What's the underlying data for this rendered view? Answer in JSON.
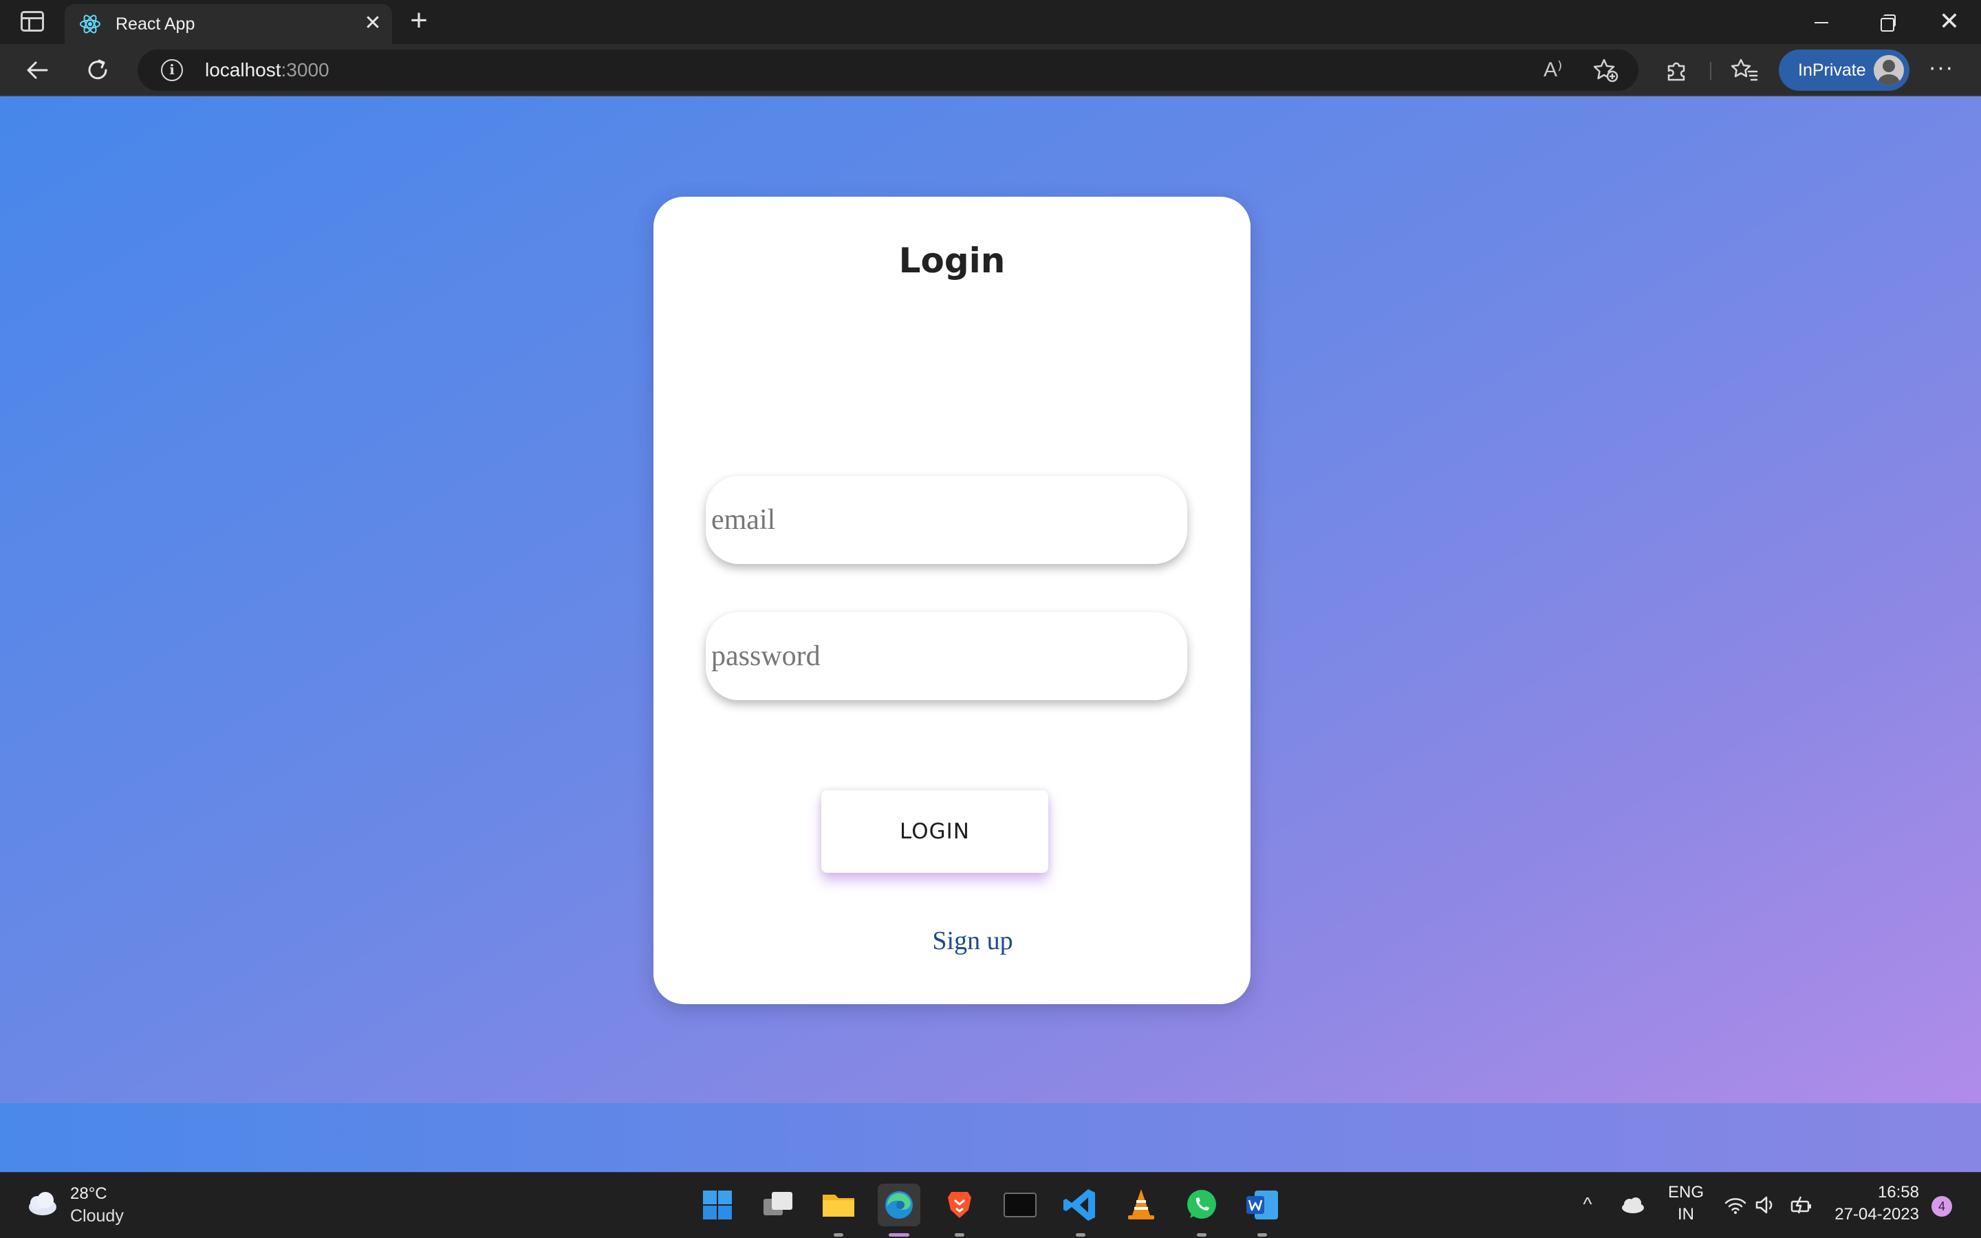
{
  "browser": {
    "tab_title": "React App",
    "url_host": "localhost",
    "url_port": ":3000",
    "inprivate_label": "InPrivate",
    "close_glyph": "✕",
    "new_tab_glyph": "+",
    "more_glyph": "···",
    "read_aloud_glyph": "A⁾",
    "info_glyph": "i",
    "win_close_glyph": "✕"
  },
  "login_card": {
    "title": "Login",
    "email_placeholder": "email",
    "password_placeholder": "password",
    "login_button": "LOGIN",
    "signup_link": "Sign up"
  },
  "taskbar": {
    "weather_temp": "28°C",
    "weather_desc": "Cloudy",
    "language_line1": "ENG",
    "language_line2": "IN",
    "time": "16:58",
    "date": "27-04-2023",
    "notification_count": "4",
    "tray_chevron": "^"
  },
  "colors": {
    "page_gradient_start": "#4787ea",
    "page_gradient_end": "#b08ce9",
    "card_background": "#ffffff",
    "inprivate_badge": "#2b5fa8",
    "signup_link": "#1e4a8a"
  }
}
